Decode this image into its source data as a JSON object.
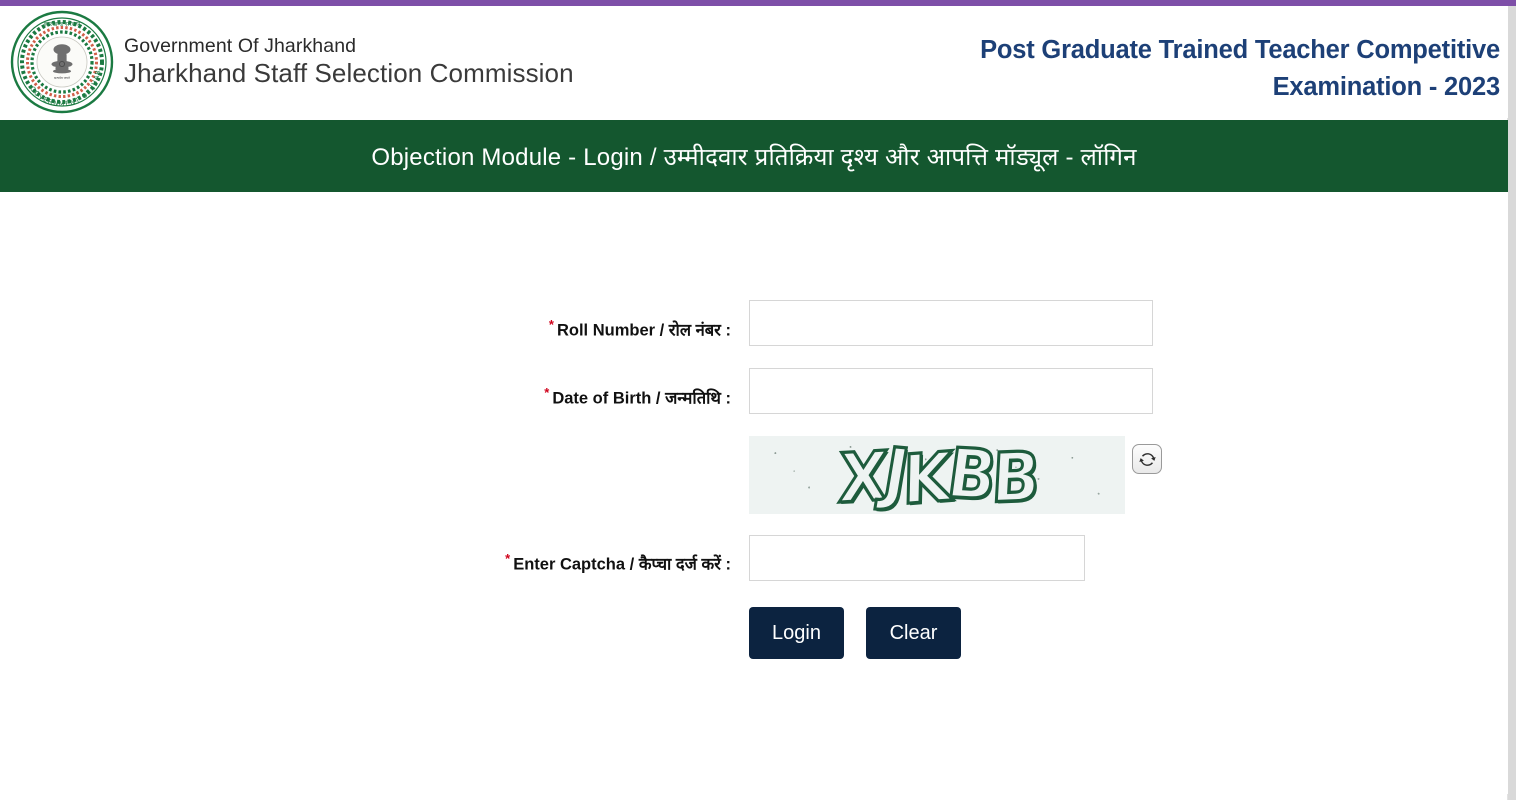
{
  "theme": {
    "accent_purple": "#7e4fa8",
    "banner_green": "#14572f",
    "title_blue": "#1d4077",
    "button_navy": "#0c2340",
    "required_red": "#d0021b"
  },
  "header": {
    "emblem_alt": "Government of Jharkhand emblem",
    "gov_line": "Government Of Jharkhand",
    "org_line": "Jharkhand Staff Selection Commission",
    "exam_title_line1": "Post Graduate Trained Teacher Competitive",
    "exam_title_line2": "Examination - 2023"
  },
  "banner": {
    "title": "Objection Module - Login / उम्मीदवार प्रतिक्रिया दृश्य और आपत्ति मॉड्यूल - लॉगिन"
  },
  "form": {
    "required_mark": "*",
    "fields": [
      {
        "name": "roll_number",
        "label": "Roll Number / रोल नंबर :",
        "value": "",
        "placeholder": ""
      },
      {
        "name": "date_of_birth",
        "label": "Date of Birth / जन्मतिथि :",
        "value": "",
        "placeholder": ""
      },
      {
        "name": "enter_captcha",
        "label": "Enter Captcha / कैप्चा दर्ज करें :",
        "value": "",
        "placeholder": ""
      }
    ],
    "captcha": {
      "code": "XJKBB",
      "refresh_icon": "refresh-icon"
    },
    "buttons": {
      "login": "Login",
      "clear": "Clear"
    }
  }
}
